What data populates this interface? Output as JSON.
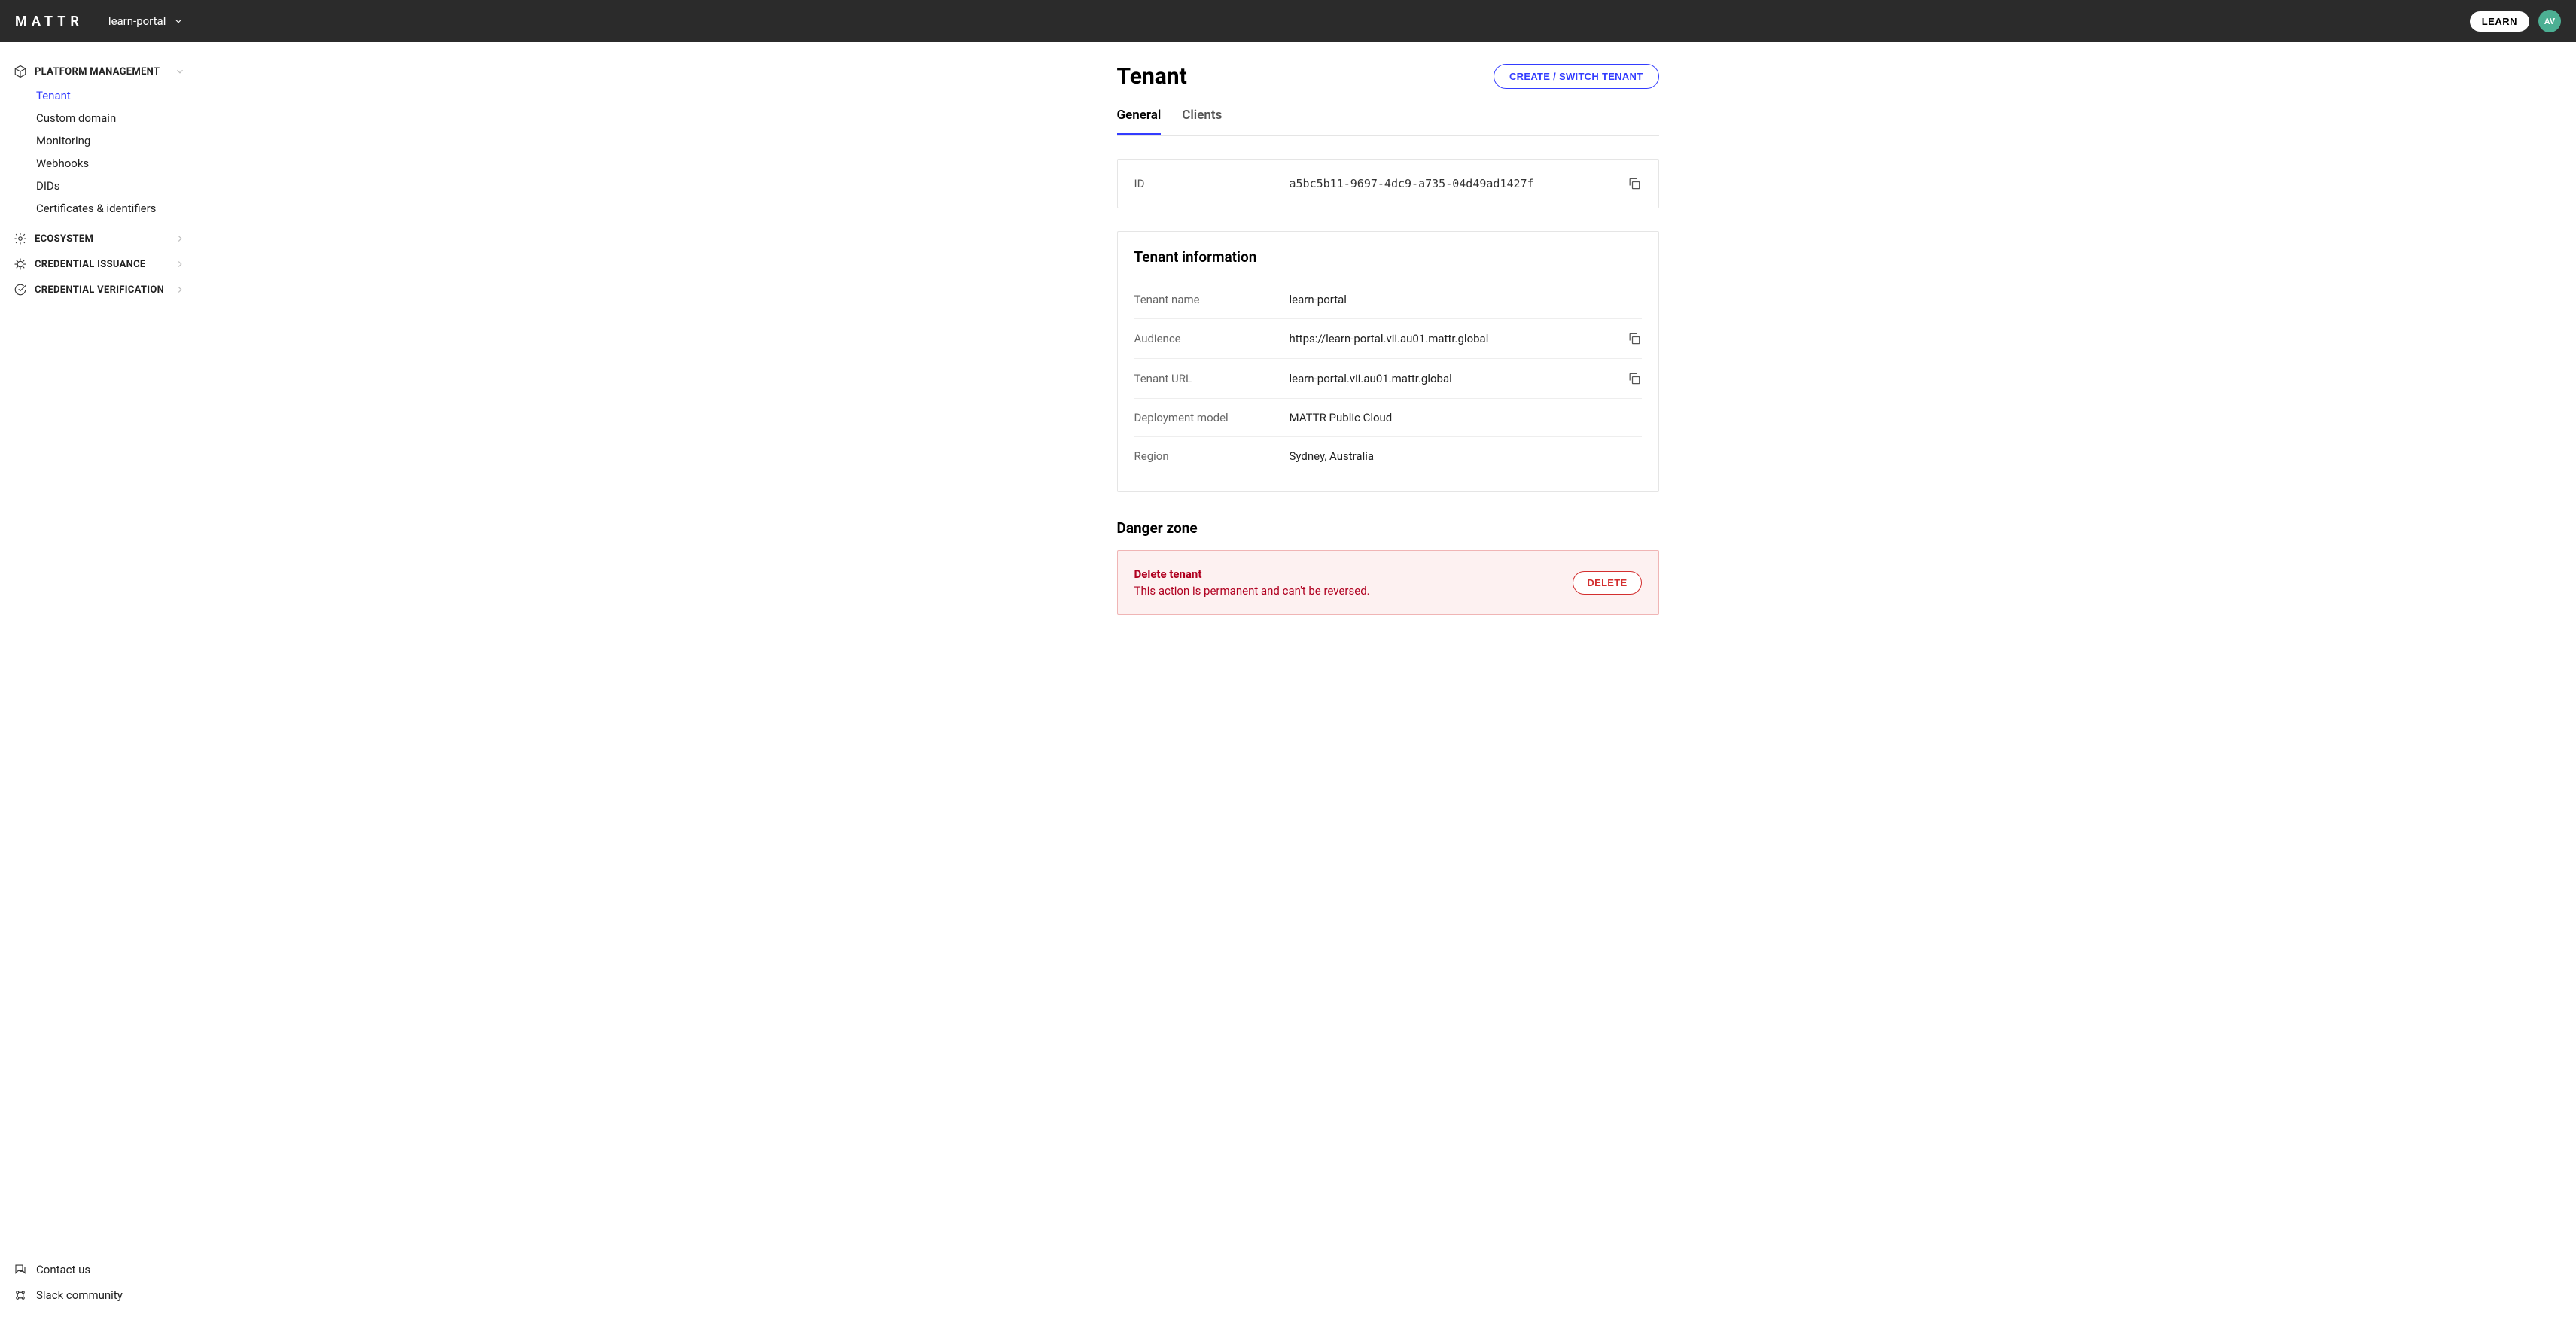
{
  "header": {
    "brand": "MATTR",
    "tenant_name": "learn-portal",
    "learn_button": "LEARN",
    "avatar_initials": "AV"
  },
  "sidebar": {
    "sections": [
      {
        "label": "PLATFORM MANAGEMENT",
        "expanded": true,
        "items": [
          {
            "label": "Tenant",
            "active": true
          },
          {
            "label": "Custom domain"
          },
          {
            "label": "Monitoring"
          },
          {
            "label": "Webhooks"
          },
          {
            "label": "DIDs"
          },
          {
            "label": "Certificates & identifiers"
          }
        ]
      },
      {
        "label": "ECOSYSTEM"
      },
      {
        "label": "CREDENTIAL ISSUANCE"
      },
      {
        "label": "CREDENTIAL VERIFICATION"
      }
    ],
    "footer": [
      {
        "label": "Contact us"
      },
      {
        "label": "Slack community"
      }
    ]
  },
  "page": {
    "title": "Tenant",
    "create_switch_btn": "CREATE / SWITCH TENANT",
    "tabs": [
      {
        "label": "General",
        "active": true
      },
      {
        "label": "Clients"
      }
    ],
    "id_field": {
      "label": "ID",
      "value": "a5bc5b11-9697-4dc9-a735-04d49ad1427f"
    },
    "info": {
      "title": "Tenant information",
      "rows": [
        {
          "label": "Tenant name",
          "value": "learn-portal"
        },
        {
          "label": "Audience",
          "value": "https://learn-portal.vii.au01.mattr.global",
          "copy": true
        },
        {
          "label": "Tenant URL",
          "value": "learn-portal.vii.au01.mattr.global",
          "copy": true
        },
        {
          "label": "Deployment model",
          "value": "MATTR Public Cloud"
        },
        {
          "label": "Region",
          "value": "Sydney, Australia"
        }
      ]
    },
    "danger": {
      "heading": "Danger zone",
      "title": "Delete tenant",
      "desc": "This action is permanent and can't be reversed.",
      "button": "DELETE"
    }
  }
}
